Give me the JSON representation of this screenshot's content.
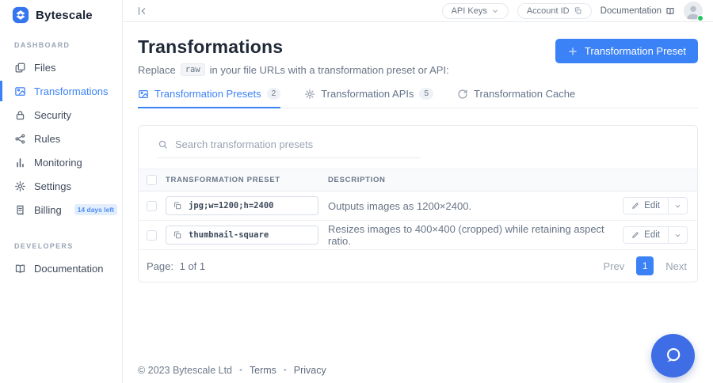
{
  "brand": {
    "name": "Bytescale"
  },
  "topbar": {
    "api_keys_label": "API Keys",
    "account_id_label": "Account ID",
    "documentation_label": "Documentation"
  },
  "sidebar": {
    "sections": [
      {
        "label": "DASHBOARD",
        "items": [
          {
            "label": "Files"
          },
          {
            "label": "Transformations",
            "active": true
          },
          {
            "label": "Security"
          },
          {
            "label": "Rules"
          },
          {
            "label": "Monitoring"
          },
          {
            "label": "Settings"
          },
          {
            "label": "Billing",
            "badge": "14 days left"
          }
        ]
      },
      {
        "label": "DEVELOPERS",
        "items": [
          {
            "label": "Documentation"
          }
        ]
      }
    ]
  },
  "page": {
    "title": "Transformations",
    "subtitle_prefix": "Replace",
    "subtitle_code": "raw",
    "subtitle_suffix": "in your file URLs with a transformation preset or API:",
    "primary_button_label": "Transformation Preset"
  },
  "tabs": [
    {
      "label": "Transformation Presets",
      "count": "2",
      "active": true
    },
    {
      "label": "Transformation APIs",
      "count": "5",
      "active": false
    },
    {
      "label": "Transformation Cache",
      "active": false
    }
  ],
  "presets_panel": {
    "search_placeholder": "Search transformation presets",
    "columns": {
      "preset": "TRANSFORMATION PRESET",
      "description": "DESCRIPTION"
    },
    "rows": [
      {
        "preset": "jpg;w=1200;h=2400",
        "description": "Outputs images as 1200×2400.",
        "edit_label": "Edit"
      },
      {
        "preset": "thumbnail-square",
        "description": "Resizes images to 400×400 (cropped) while retaining aspect ratio.",
        "edit_label": "Edit"
      }
    ],
    "pagination": {
      "page_label": "Page:",
      "page_value": "1 of 1",
      "prev": "Prev",
      "current": "1",
      "next": "Next"
    }
  },
  "footer": {
    "copyright": "© 2023 Bytescale Ltd",
    "terms": "Terms",
    "privacy": "Privacy"
  },
  "colors": {
    "accent": "#3b82f6",
    "badge_bg": "#e3eefc",
    "chat_fab": "#3e6de6",
    "online": "#22c55e",
    "table_header_bg": "#f8fafc"
  }
}
